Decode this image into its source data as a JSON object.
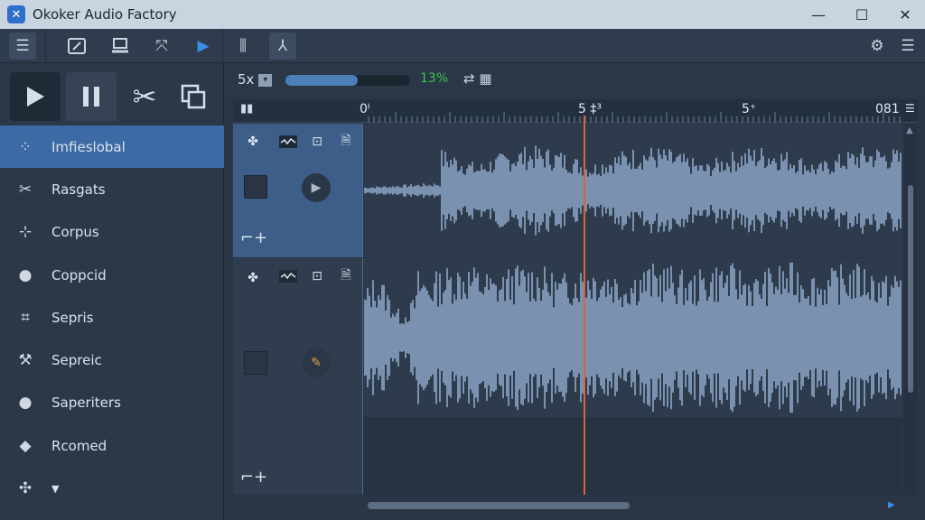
{
  "window": {
    "title": "Okoker Audio Factory",
    "app_icon": "scissors-icon",
    "controls": [
      "minimize-icon",
      "maximize-icon",
      "close-icon"
    ]
  },
  "toolbar": {
    "left_icons": [
      "menu-icon",
      "edit-icon",
      "import-icon",
      "transform-icon",
      "play-icon",
      "mixer-icon",
      "split-icon"
    ],
    "right_icons": [
      "gear-icon",
      "list-settings-icon"
    ],
    "accent": "#3b8ee8"
  },
  "transport": {
    "buttons": [
      "play-icon",
      "pause-icon",
      "cut-icon",
      "copy-icon"
    ]
  },
  "sidebar": {
    "items": [
      {
        "icon": "dots-grid-icon",
        "label": "Imfieslobal",
        "active": true
      },
      {
        "icon": "scissors-icon",
        "label": "Rasgats",
        "active": false
      },
      {
        "icon": "split-line-icon",
        "label": "Corpus",
        "active": false
      },
      {
        "icon": "user-icon",
        "label": "Coppcid",
        "active": false
      },
      {
        "icon": "crop-icon",
        "label": "Sepris",
        "active": false
      },
      {
        "icon": "magic-wand-icon",
        "label": "Sepreic",
        "active": false
      },
      {
        "icon": "user-icon",
        "label": "Saperiters",
        "active": false
      },
      {
        "icon": "eraser-icon",
        "label": "Rcomed",
        "active": false
      },
      {
        "icon": "settings-dropdown-icon",
        "label": "",
        "active": false
      }
    ]
  },
  "zoom": {
    "label": "5x",
    "progress_percent": 13,
    "progress_fill_fraction": 0.58,
    "percent_text": "13%",
    "percent_color": "#3cc24a"
  },
  "ruler": {
    "labels": [
      "0ᴵ",
      "5 ‡³",
      "5⁺",
      "081"
    ]
  },
  "tracks": [
    {
      "header_icons": [
        "effects-icon",
        "waveform-icon",
        "resize-icon",
        "document-icon"
      ],
      "action_icon": "play-icon",
      "footer_icon": "crop-add-icon",
      "selected": true
    },
    {
      "header_icons": [
        "effects-icon",
        "waveform-icon",
        "resize-icon",
        "document-icon"
      ],
      "action_icon": "pen-icon",
      "footer_icon": "crop-add-icon",
      "selected": false
    }
  ],
  "colors": {
    "waveform": "#8ea9c8",
    "playhead": "#e0623a",
    "active_nav": "#3b6aa5"
  }
}
